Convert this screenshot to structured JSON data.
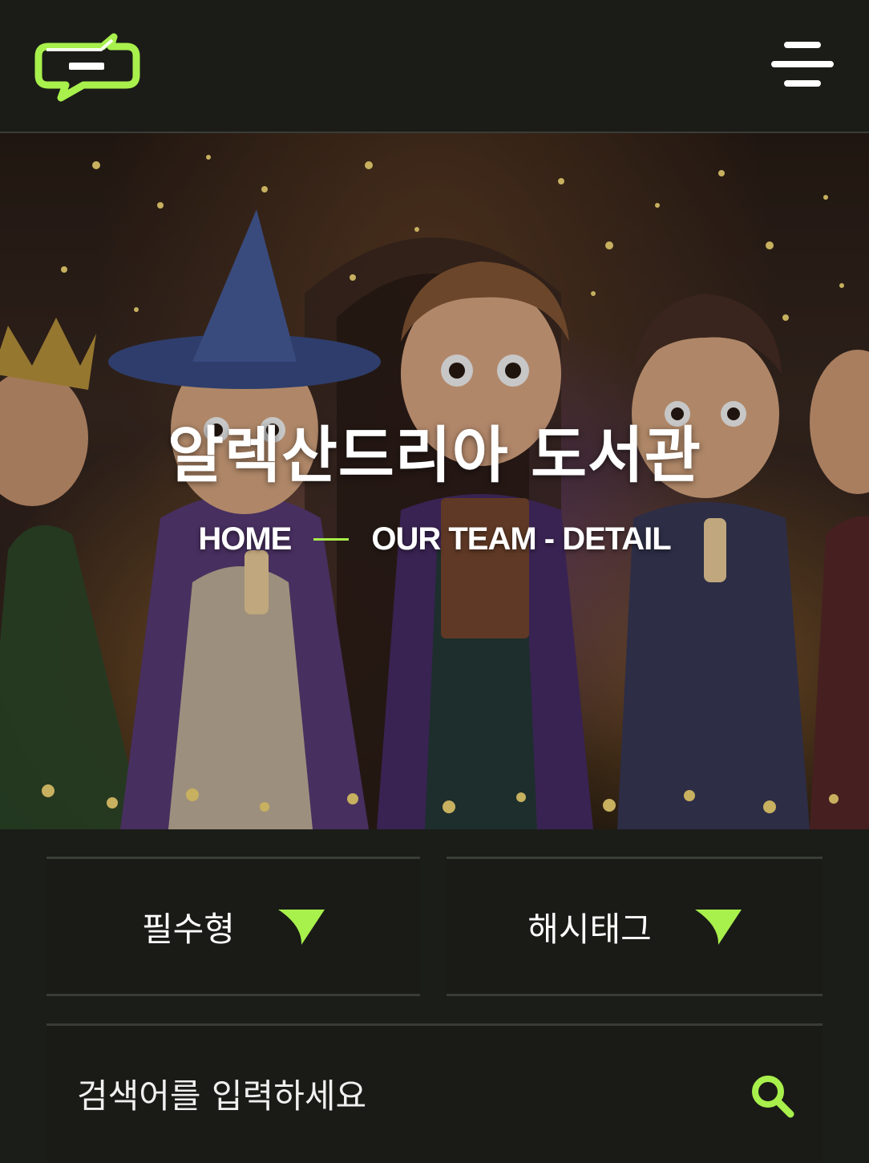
{
  "header": {
    "logo_icon": "chat-bubble-logo-icon",
    "menu_icon": "hamburger-menu-icon",
    "accent_color": "#a8f04c"
  },
  "hero": {
    "title": "알렉산드리아 도서관",
    "breadcrumb": {
      "home": "HOME",
      "current": "OUR TEAM - DETAIL"
    },
    "image": "children-in-wizard-costumes-holding-candles-and-book"
  },
  "filters": [
    {
      "label": "필수형",
      "icon": "triangle-arrow-down-icon"
    },
    {
      "label": "해시태그",
      "icon": "triangle-arrow-down-icon"
    }
  ],
  "search": {
    "placeholder": "검색어를 입력하세요",
    "icon": "search-icon"
  }
}
